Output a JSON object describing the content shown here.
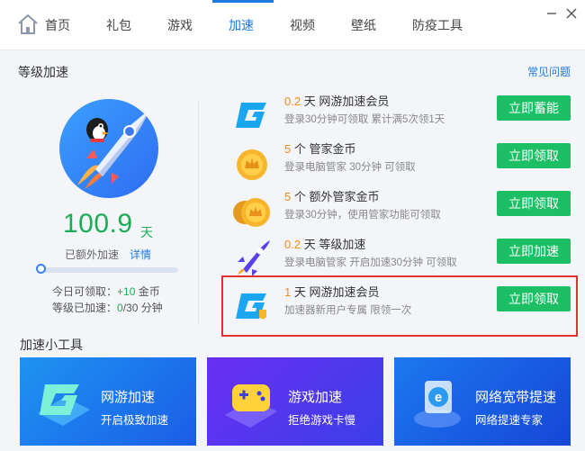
{
  "nav": {
    "tabs": [
      {
        "label": "首页"
      },
      {
        "label": "礼包"
      },
      {
        "label": "游戏"
      },
      {
        "label": "加速"
      },
      {
        "label": "视频"
      },
      {
        "label": "壁纸"
      },
      {
        "label": "防疫工具"
      }
    ],
    "active_tab": "加速"
  },
  "section": {
    "title": "等级加速",
    "faq_link": "常见问题"
  },
  "summary": {
    "value": "100.9",
    "unit": "天",
    "extra_label": "已额外加速",
    "detail_link": "详情",
    "progress_fraction": 0.0,
    "today_label": "今日可领取：",
    "today_value": "+10",
    "today_unit": "金币",
    "level_label": "等级已加速：",
    "level_value": "0",
    "level_total": "/30 分钟"
  },
  "rewards": [
    {
      "amount": "0.2",
      "unit": "天",
      "name": "网游加速会员",
      "desc": "登录30分钟可领取 累计满5次领1天",
      "button": "立即蓄能",
      "icon": "game-accelerator-g-icon"
    },
    {
      "amount": "5",
      "unit": "个",
      "name": "管家金币",
      "desc": "登录电脑管家 30分钟 可领取",
      "button": "立即领取",
      "icon": "gold-coin-icon"
    },
    {
      "amount": "5",
      "unit": "个",
      "name": "额外管家金币",
      "desc": "登录30分钟，使用管家功能可领取",
      "button": "立即领取",
      "icon": "gold-coins-stack-icon"
    },
    {
      "amount": "0.2",
      "unit": "天",
      "name": "等级加速",
      "desc": "登录电脑管家 开启加速30分钟 可领取",
      "button": "立即加速",
      "icon": "rocket-icon"
    },
    {
      "amount": "1",
      "unit": "天",
      "name": "网游加速会员",
      "desc": "加速器新用户专属 限领一次",
      "button": "立即领取",
      "icon": "game-accelerator-g-shield-icon"
    }
  ],
  "tools": {
    "title": "加速小工具",
    "cards": [
      {
        "title": "网游加速",
        "subtitle": "开启极致加速",
        "icon": "game-accelerator-icon",
        "color_from": "#1d8cf0",
        "color_to": "#1b5fe8"
      },
      {
        "title": "游戏加速",
        "subtitle": "拒绝游戏卡慢",
        "icon": "gamepad-icon",
        "color_from": "#5b2ff0",
        "color_to": "#3a3ae8"
      },
      {
        "title": "网络宽带提速",
        "subtitle": "网络提速专家",
        "icon": "ie-browser-icon",
        "color_from": "#1c73f0",
        "color_to": "#1848d8"
      }
    ]
  },
  "colors": {
    "accent": "#1f7ae0",
    "green": "#1cbf64",
    "orange": "#f08c1e",
    "highlight": "#e0312e"
  }
}
